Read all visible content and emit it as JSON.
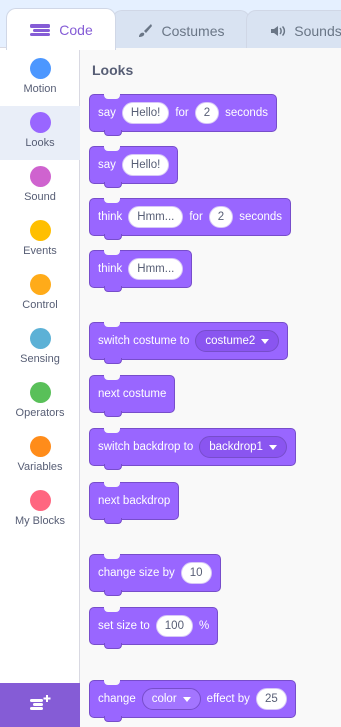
{
  "tabs": {
    "code": "Code",
    "costumes": "Costumes",
    "sounds": "Sounds"
  },
  "sidebar": {
    "items": [
      {
        "label": "Motion",
        "color": "#4c97ff"
      },
      {
        "label": "Looks",
        "color": "#9966ff",
        "selected": true
      },
      {
        "label": "Sound",
        "color": "#cf63cf"
      },
      {
        "label": "Events",
        "color": "#ffbf00"
      },
      {
        "label": "Control",
        "color": "#ffab19"
      },
      {
        "label": "Sensing",
        "color": "#5cb1d6"
      },
      {
        "label": "Operators",
        "color": "#59c059"
      },
      {
        "label": "Variables",
        "color": "#ff8c1a"
      },
      {
        "label": "My Blocks",
        "color": "#ff6680"
      }
    ],
    "extension_icon": "add-extension-icon"
  },
  "palette": {
    "section_title": "Looks",
    "blocks": {
      "say_for": {
        "text1": "say",
        "msg": "Hello!",
        "text2": "for",
        "secs": "2",
        "text3": "seconds"
      },
      "say": {
        "text1": "say",
        "msg": "Hello!"
      },
      "think_for": {
        "text1": "think",
        "msg": "Hmm...",
        "text2": "for",
        "secs": "2",
        "text3": "seconds"
      },
      "think": {
        "text1": "think",
        "msg": "Hmm..."
      },
      "switch_costume": {
        "text": "switch costume to",
        "value": "costume2"
      },
      "next_costume": {
        "text": "next costume"
      },
      "switch_backdrop": {
        "text": "switch backdrop to",
        "value": "backdrop1"
      },
      "next_backdrop": {
        "text": "next backdrop"
      },
      "change_size": {
        "text": "change size by",
        "value": "10"
      },
      "set_size": {
        "text1": "set size to",
        "value": "100",
        "text2": "%"
      },
      "change_effect": {
        "text1": "change",
        "effect": "color",
        "text2": "effect by",
        "value": "25"
      }
    }
  },
  "colors": {
    "looks": "#9966ff",
    "accent": "#855cd6"
  }
}
